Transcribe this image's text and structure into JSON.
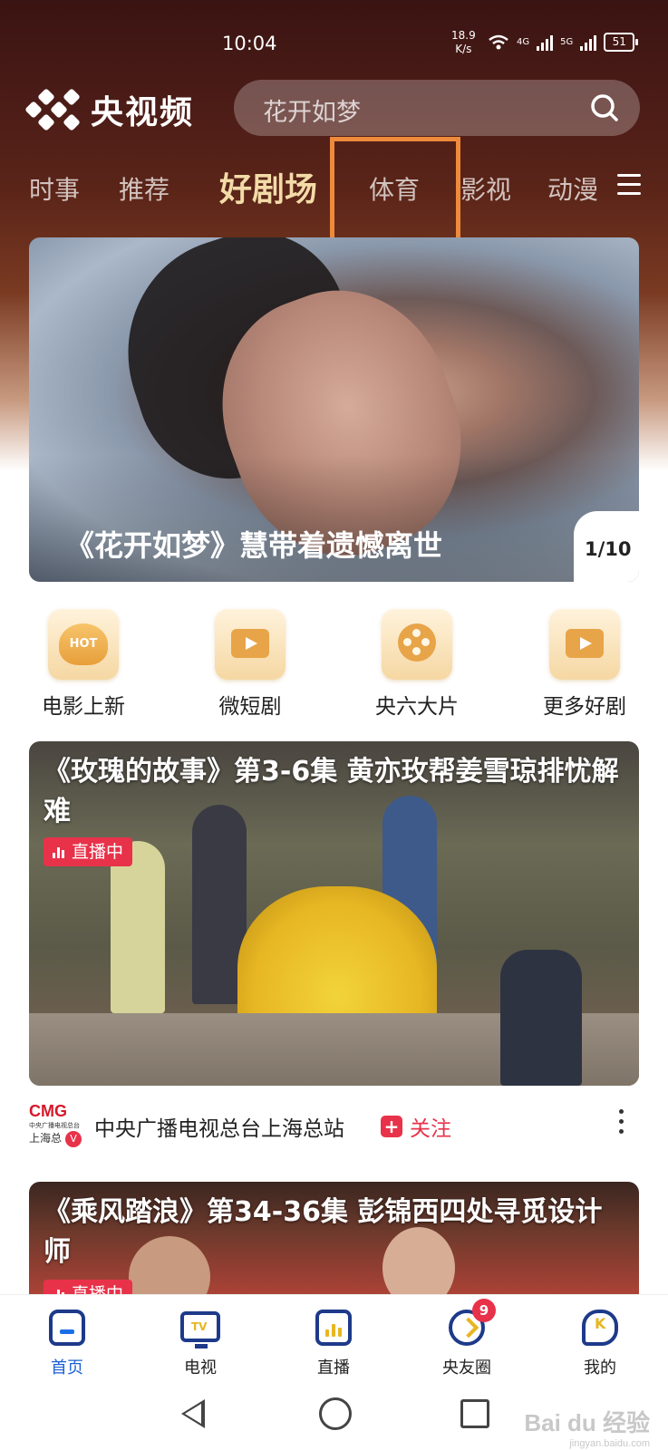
{
  "status_bar": {
    "time": "10:04",
    "speed_value": "18.9",
    "speed_unit": "K/s",
    "net1": "4G",
    "net2": "5G",
    "battery": "51"
  },
  "header": {
    "logo_text": "央视频",
    "search_placeholder": "花开如梦"
  },
  "tabs": [
    {
      "label": "时事",
      "active": false
    },
    {
      "label": "推荐",
      "active": false
    },
    {
      "label": "好剧场",
      "active": true
    },
    {
      "label": "体育",
      "active": false
    },
    {
      "label": "影视",
      "active": false
    },
    {
      "label": "动漫",
      "active": false
    }
  ],
  "banner": {
    "title": "《花开如梦》慧带着遗憾离世",
    "counter": "1/10"
  },
  "shortcuts": [
    {
      "label": "电影上新",
      "icon": "hot-icon",
      "badge": "HOT"
    },
    {
      "label": "微短剧",
      "icon": "video-camera-icon"
    },
    {
      "label": "央六大片",
      "icon": "film-reel-icon"
    },
    {
      "label": "更多好剧",
      "icon": "folder-play-icon"
    }
  ],
  "feed": [
    {
      "title": "《玫瑰的故事》第3-6集 黄亦玫帮姜雪琼排忧解难",
      "badge": "直播中"
    },
    {
      "title": "《乘风踏浪》第34-36集 彭锦西四处寻觅设计师",
      "badge": "直播中"
    }
  ],
  "source": {
    "logo_top": "CMG",
    "logo_sub": "中央广播电视总台",
    "logo_bottom": "上海总",
    "name": "中央广播电视总台上海总站",
    "follow_label": "关注"
  },
  "bottom_nav": [
    {
      "label": "首页",
      "icon": "home-icon",
      "active": true
    },
    {
      "label": "电视",
      "icon": "tv-icon",
      "active": false
    },
    {
      "label": "直播",
      "icon": "live-icon",
      "active": false
    },
    {
      "label": "央友圈",
      "icon": "compass-icon",
      "active": false,
      "badge": "9"
    },
    {
      "label": "我的",
      "icon": "profile-icon",
      "active": false
    }
  ],
  "watermark": {
    "text": "Bai du 经验",
    "sub": "jingyan.baidu.com"
  },
  "colors": {
    "accent_red": "#e8324a",
    "active_tab": "#f3dba8",
    "nav_active": "#1b5fd6",
    "highlight_box": "#ee8a3c"
  }
}
